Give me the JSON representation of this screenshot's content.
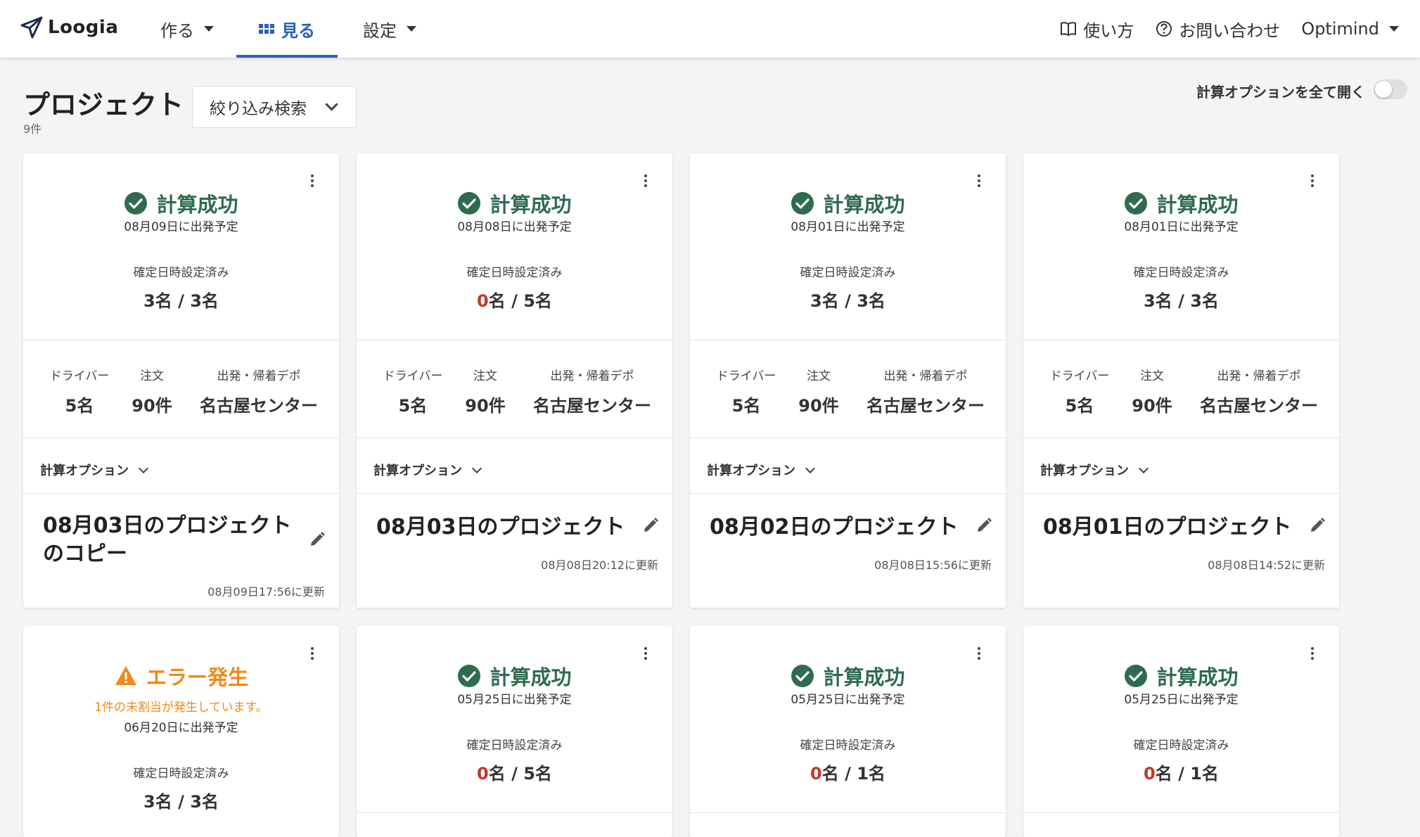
{
  "nav": {
    "logo": "Loogia",
    "make": "作る",
    "view": "見る",
    "settings": "設定",
    "usage": "使い方",
    "contact": "お問い合わせ",
    "user": "Optimind"
  },
  "header": {
    "title": "プロジェクト",
    "count": "9件",
    "filter": "絞り込み検索",
    "toggle_label": "計算オプションを全て開く"
  },
  "labels": {
    "fixed": "確定日時設定済み",
    "driver": "ドライバー",
    "order": "注文",
    "depot": "出発・帰着デポ",
    "calc_option": "計算オプション"
  },
  "colors": {
    "success": "#2f6b4f",
    "error": "#ef8a17",
    "zero": "#c0392b",
    "accent": "#2a60b8"
  },
  "cards": [
    {
      "status": "計算成功",
      "depart": "08月09日に出発予定",
      "fixed_done": "3",
      "fixed_rest": "名 / 3名",
      "drivers": "5名",
      "orders": "90件",
      "depot": "名古屋センター",
      "name": "08月03日のプロジェクトのコピー",
      "updated": "08月09日17:56に更新"
    },
    {
      "status": "計算成功",
      "depart": "08月08日に出発予定",
      "fixed_done": "0",
      "fixed_rest": "名 / 5名",
      "drivers": "5名",
      "orders": "90件",
      "depot": "名古屋センター",
      "name": "08月03日のプロジェクト",
      "updated": "08月08日20:12に更新"
    },
    {
      "status": "計算成功",
      "depart": "08月01日に出発予定",
      "fixed_done": "3",
      "fixed_rest": "名 / 3名",
      "drivers": "5名",
      "orders": "90件",
      "depot": "名古屋センター",
      "name": "08月02日のプロジェクト",
      "updated": "08月08日15:56に更新"
    },
    {
      "status": "計算成功",
      "depart": "08月01日に出発予定",
      "fixed_done": "3",
      "fixed_rest": "名 / 3名",
      "drivers": "5名",
      "orders": "90件",
      "depot": "名古屋センター",
      "name": "08月01日のプロジェクト",
      "updated": "08月08日14:52に更新"
    },
    {
      "status": "エラー発生",
      "error_msg": "1件の未割当が発生しています。",
      "depart": "06月20日に出発予定",
      "fixed_done": "3",
      "fixed_rest": "名 / 3名"
    },
    {
      "status": "計算成功",
      "depart": "05月25日に出発予定",
      "fixed_done": "0",
      "fixed_rest": "名 / 5名"
    },
    {
      "status": "計算成功",
      "depart": "05月25日に出発予定",
      "fixed_done": "0",
      "fixed_rest": "名 / 1名"
    },
    {
      "status": "計算成功",
      "depart": "05月25日に出発予定",
      "fixed_done": "0",
      "fixed_rest": "名 / 1名"
    }
  ]
}
